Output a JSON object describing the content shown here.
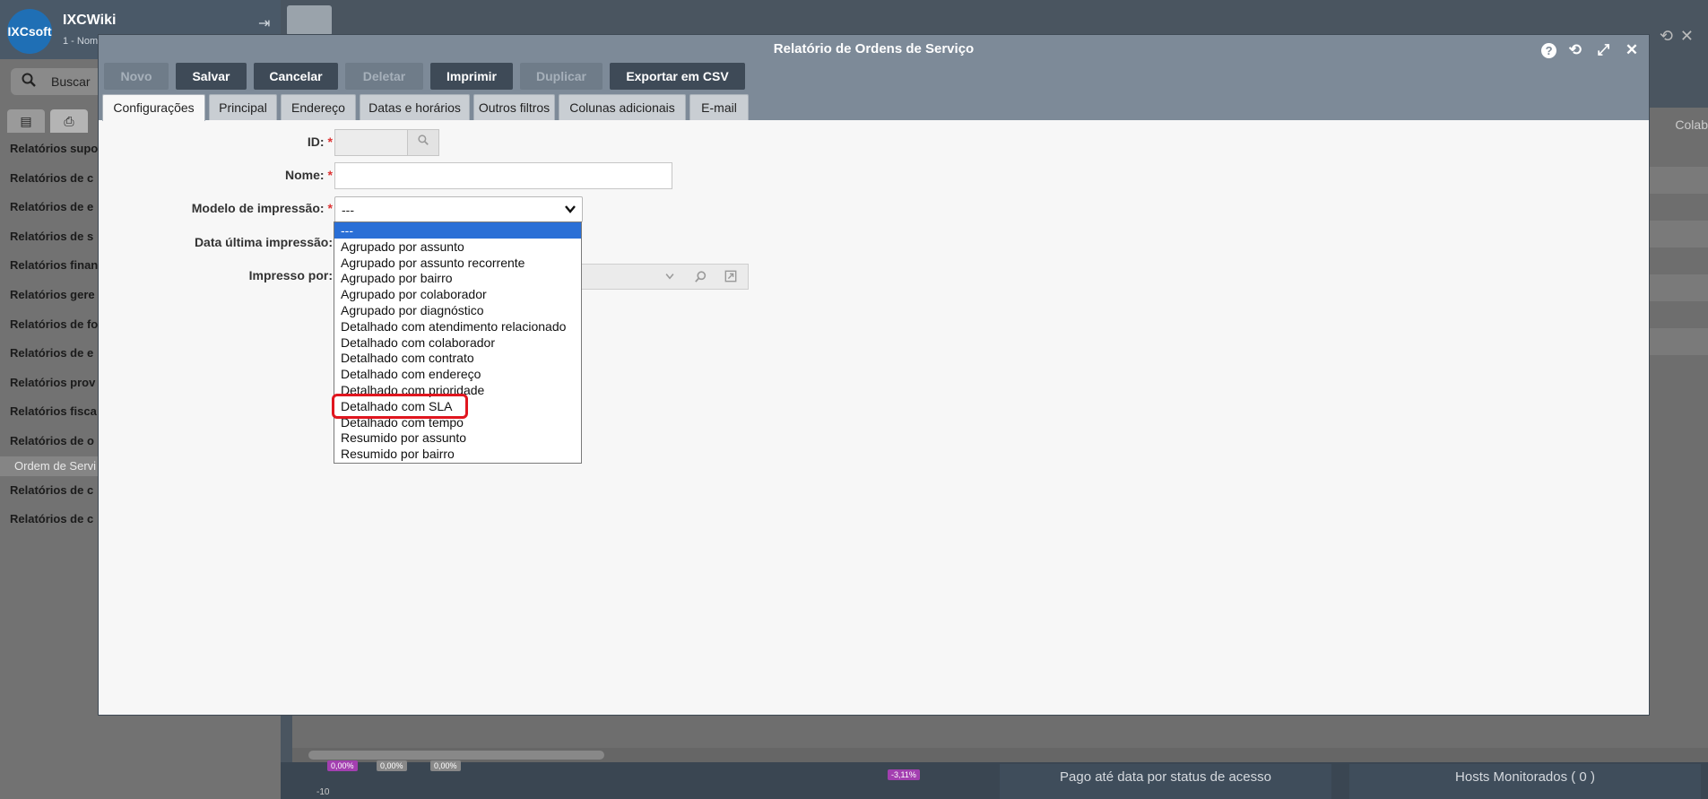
{
  "sidebar": {
    "app_title": "IXCWiki",
    "app_subtitle": "1 - Nom",
    "logo_text": "IXCsoft",
    "search_placeholder": "Buscar",
    "items": [
      {
        "label": "Relatórios supo"
      },
      {
        "label": "Relatórios de c"
      },
      {
        "label": "Relatórios de e"
      },
      {
        "label": "Relatórios de s"
      },
      {
        "label": "Relatórios finan"
      },
      {
        "label": "Relatórios gere"
      },
      {
        "label": "Relatórios de fo"
      },
      {
        "label": "Relatórios de e"
      },
      {
        "label": "Relatórios prov"
      },
      {
        "label": "Relatórios fisca"
      },
      {
        "label": "Relatórios de o"
      },
      {
        "label": "Ordem de Servi",
        "active": true
      },
      {
        "label": "Relatórios de c"
      },
      {
        "label": "Relatórios de c"
      }
    ]
  },
  "background": {
    "right_header": "Colab",
    "card_1": "Pago até data por status de acesso",
    "card_2": "Hosts Monitorados ( 0 )",
    "chips": [
      "0,00%",
      "0,00%",
      "0,00%",
      "-3,11%"
    ],
    "axis_label": "-10"
  },
  "modal": {
    "title": "Relatório de Ordens de Serviço",
    "toolbar": {
      "novo": "Novo",
      "salvar": "Salvar",
      "cancelar": "Cancelar",
      "deletar": "Deletar",
      "imprimir": "Imprimir",
      "duplicar": "Duplicar",
      "exportar": "Exportar em CSV"
    },
    "tabs": [
      "Configurações",
      "Principal",
      "Endereço",
      "Datas e horários",
      "Outros filtros",
      "Colunas adicionais",
      "E-mail"
    ],
    "form": {
      "id_label": "ID:",
      "nome_label": "Nome:",
      "modelo_label": "Modelo de impressão:",
      "data_label": "Data última impressão:",
      "impresso_label": "Impresso por:",
      "required_mark": "*",
      "modelo_value": "---"
    },
    "dropdown_options": [
      "---",
      "Agrupado por assunto",
      "Agrupado por assunto recorrente",
      "Agrupado por bairro",
      "Agrupado por colaborador",
      "Agrupado por diagnóstico",
      "Detalhado com atendimento relacionado",
      "Detalhado com colaborador",
      "Detalhado com contrato",
      "Detalhado com endereço",
      "Detalhado com prioridade",
      "Detalhado com SLA",
      "Detalhado com tempo",
      "Resumido por assunto",
      "Resumido por bairro"
    ],
    "selected_option": "---",
    "highlighted_option": "Detalhado com SLA"
  },
  "colors": {
    "modal_header": "#7d8a98",
    "toolbar_button": "#3e4a57",
    "selected_option": "#2a6fd6",
    "highlight": "#e0161f",
    "required": "#d33"
  }
}
